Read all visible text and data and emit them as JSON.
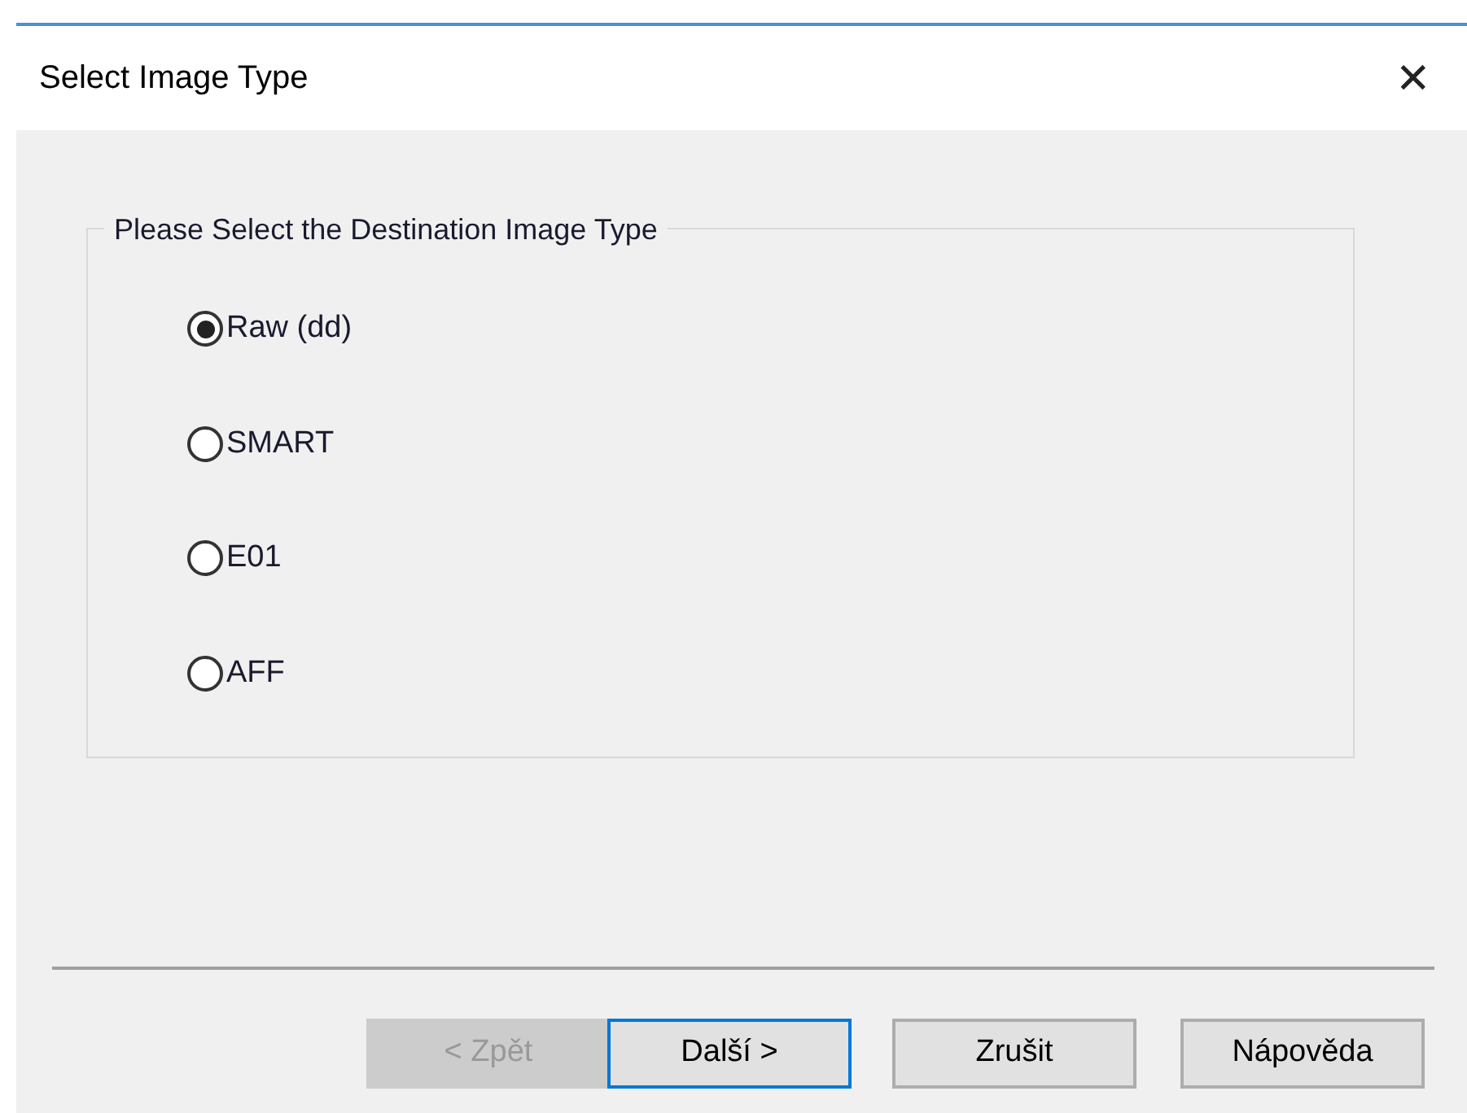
{
  "window": {
    "title": "Select Image Type",
    "close": "✕"
  },
  "group": {
    "title": "Please Select the Destination Image Type",
    "options": [
      {
        "label": "Raw (dd)",
        "selected": true
      },
      {
        "label": "SMART",
        "selected": false
      },
      {
        "label": "E01",
        "selected": false
      },
      {
        "label": "AFF",
        "selected": false
      }
    ]
  },
  "buttons": [
    {
      "label": "< Zpět",
      "disabled": true,
      "default": false
    },
    {
      "label": "Další >",
      "disabled": false,
      "default": true
    },
    {
      "label": "Zrušit",
      "disabled": false,
      "default": false
    },
    {
      "label": "Nápověda",
      "disabled": false,
      "default": false
    }
  ]
}
